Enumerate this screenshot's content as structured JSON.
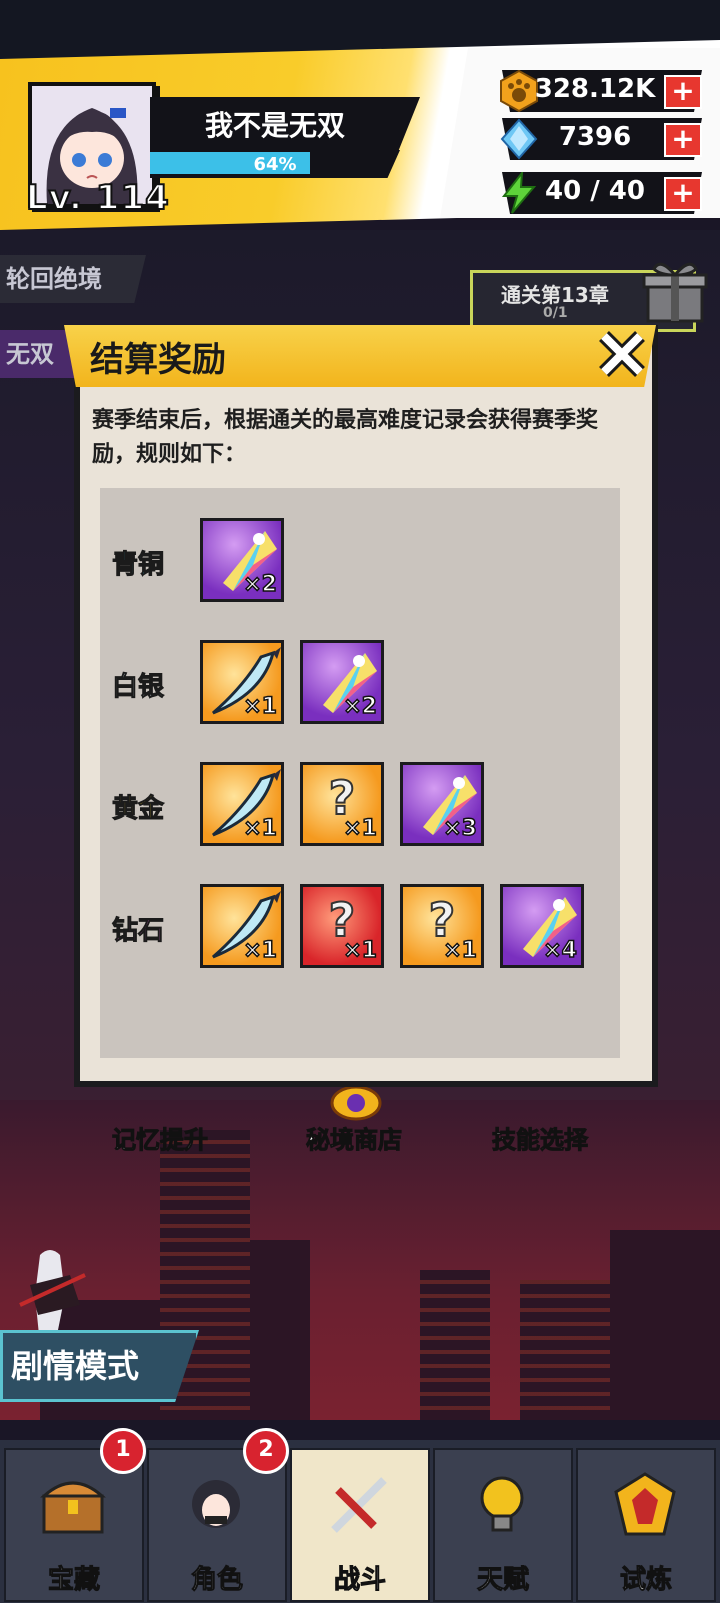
{
  "player": {
    "name": "我不是无双",
    "level_label": "Lv. 114",
    "xp_percent": "64%",
    "xp_fraction": 0.64
  },
  "resources": [
    {
      "icon": "paw-coin-icon",
      "value": "328.12K"
    },
    {
      "icon": "diamond-icon",
      "value": "7396"
    },
    {
      "icon": "energy-bolt-icon",
      "value": "40 / 40"
    }
  ],
  "side_tabs": {
    "tab1": "轮回绝境",
    "tab2": "无双"
  },
  "chapter_task": {
    "title": "通关第13章",
    "progress": "0/1"
  },
  "modal": {
    "title": "结算奖励",
    "description": "赛季结束后，根据通关的最高难度记录会获得赛季奖励，规则如下：",
    "tiers": [
      {
        "name": "青铜",
        "color": "#2fb6cf",
        "rewards": [
          {
            "type": "crystal",
            "count": "×2"
          }
        ]
      },
      {
        "name": "白银",
        "color": "#dce6ee",
        "rewards": [
          {
            "type": "blade",
            "count": "×1"
          },
          {
            "type": "crystal",
            "count": "×2"
          }
        ]
      },
      {
        "name": "黄金",
        "color": "#f3d024",
        "rewards": [
          {
            "type": "blade",
            "count": "×1"
          },
          {
            "type": "mystery-orange",
            "count": "×1"
          },
          {
            "type": "crystal",
            "count": "×3"
          }
        ]
      },
      {
        "name": "钻石",
        "color": "#e46ad8",
        "rewards": [
          {
            "type": "blade",
            "count": "×1"
          },
          {
            "type": "mystery-red",
            "count": "×1"
          },
          {
            "type": "mystery-orange",
            "count": "×1"
          },
          {
            "type": "crystal",
            "count": "×4"
          }
        ]
      }
    ]
  },
  "menu": {
    "memory_upgrade": "记忆提升",
    "secret_shop": "秘境商店",
    "skill_select": "技能选择",
    "story_mode": "剧情模式"
  },
  "navbar": [
    {
      "label": "宝藏",
      "badge": "1",
      "icon": "treasure-chest-icon"
    },
    {
      "label": "角色",
      "badge": "2",
      "icon": "character-icon"
    },
    {
      "label": "战斗",
      "badge": "",
      "icon": "battle-swords-icon",
      "active": true
    },
    {
      "label": "天赋",
      "badge": "",
      "icon": "lightbulb-icon"
    },
    {
      "label": "试炼",
      "badge": "",
      "icon": "trial-emblem-icon"
    }
  ]
}
